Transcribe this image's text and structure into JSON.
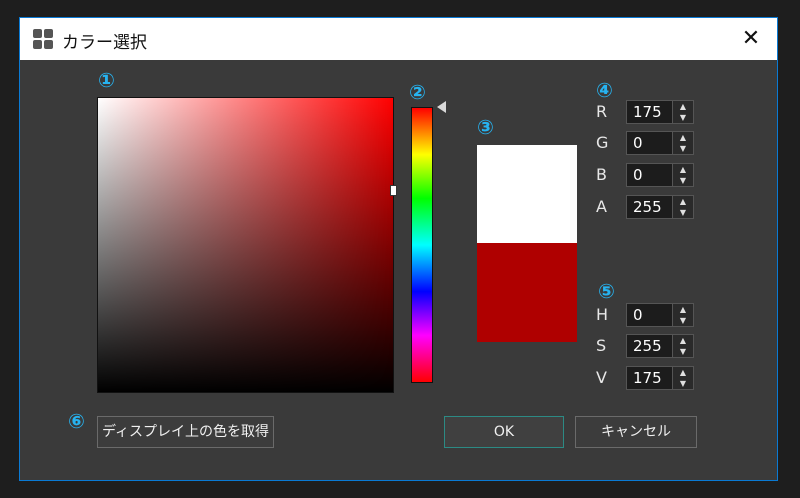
{
  "window": {
    "title": "カラー選択",
    "app_icon": "app-grid-icon",
    "close_icon": "close-icon",
    "close_glyph": "✕",
    "accent_color": "#0a7ad4"
  },
  "markers": {
    "one": "①",
    "two": "②",
    "three": "③",
    "four": "④",
    "five": "⑤",
    "six": "⑥",
    "color": "#27b3f0"
  },
  "picker": {
    "hue_color": "#ff0000",
    "current_hue": 0,
    "saturation": 255,
    "value": 175
  },
  "preview": {
    "old_color": "#ffffff",
    "new_color": "#af0000"
  },
  "rgba": [
    {
      "label": "R",
      "value": "175"
    },
    {
      "label": "G",
      "value": "0"
    },
    {
      "label": "B",
      "value": "0"
    },
    {
      "label": "A",
      "value": "255"
    }
  ],
  "hsv": [
    {
      "label": "H",
      "value": "0"
    },
    {
      "label": "S",
      "value": "255"
    },
    {
      "label": "V",
      "value": "175"
    }
  ],
  "spinner": {
    "up_glyph": "▲",
    "down_glyph": "▼"
  },
  "buttons": {
    "eyedropper": "ディスプレイ上の色を取得",
    "ok": "OK",
    "cancel": "キャンセル"
  }
}
